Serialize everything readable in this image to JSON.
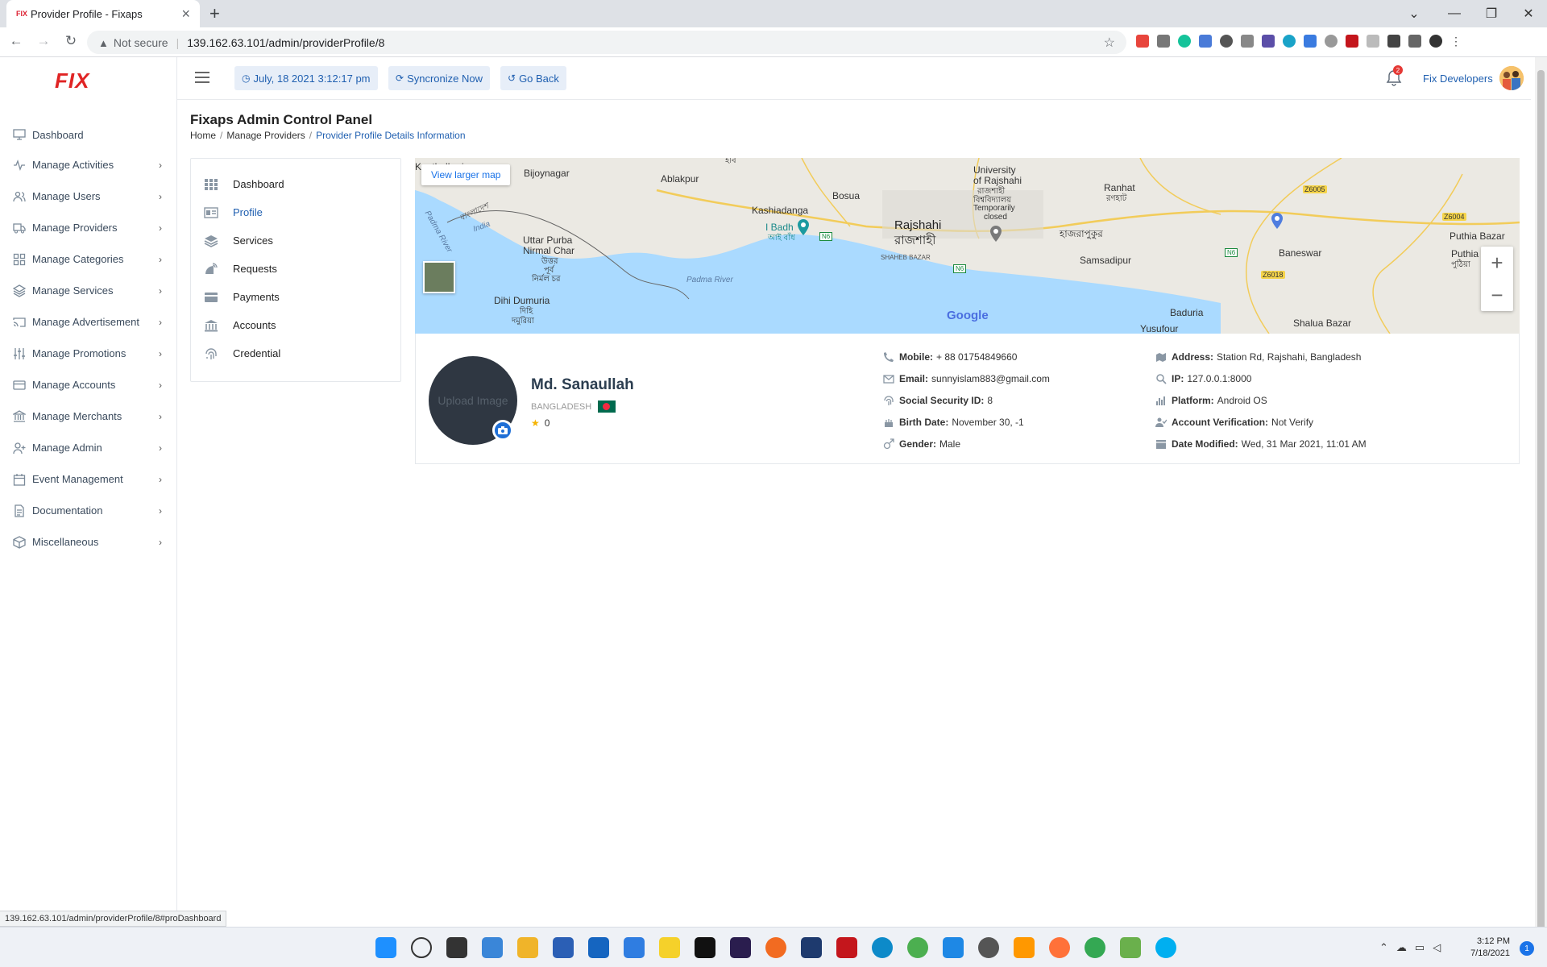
{
  "browser": {
    "tab_title": "Provider Profile - Fixaps",
    "favicon_text": "FIX",
    "security_label": "Not secure",
    "url": "139.162.63.101/admin/providerProfile/8",
    "status_url": "139.162.63.101/admin/providerProfile/8#proDashboard"
  },
  "app": {
    "logo_text": "FIX",
    "brand_color": "#e02424",
    "accent_color": "#1f5fb0"
  },
  "sidebar": {
    "items": [
      {
        "label": "Dashboard",
        "icon": "monitor-icon",
        "has_children": false
      },
      {
        "label": "Manage Activities",
        "icon": "activity-icon",
        "has_children": true
      },
      {
        "label": "Manage Users",
        "icon": "users-icon",
        "has_children": true
      },
      {
        "label": "Manage Providers",
        "icon": "truck-icon",
        "has_children": true
      },
      {
        "label": "Manage Categories",
        "icon": "grid-icon",
        "has_children": true
      },
      {
        "label": "Manage Services",
        "icon": "layers-icon",
        "has_children": true
      },
      {
        "label": "Manage Advertisement",
        "icon": "cast-icon",
        "has_children": true
      },
      {
        "label": "Manage Promotions",
        "icon": "sliders-icon",
        "has_children": true
      },
      {
        "label": "Manage Accounts",
        "icon": "credit-card-icon",
        "has_children": true
      },
      {
        "label": "Manage Merchants",
        "icon": "bank-icon",
        "has_children": true
      },
      {
        "label": "Manage Admin",
        "icon": "user-plus-icon",
        "has_children": true
      },
      {
        "label": "Event Management",
        "icon": "calendar-icon",
        "has_children": true
      },
      {
        "label": "Documentation",
        "icon": "file-icon",
        "has_children": true
      },
      {
        "label": "Miscellaneous",
        "icon": "box-icon",
        "has_children": true
      }
    ]
  },
  "header": {
    "datetime_label": "July, 18 2021 3:12:17 pm",
    "sync_label": "Syncronize Now",
    "back_label": "Go Back",
    "notification_count": "2",
    "user_name": "Fix Developers"
  },
  "page": {
    "title": "Fixaps Admin Control Panel",
    "breadcrumb": [
      "Home",
      "Manage Providers",
      "Provider Profile Details Information"
    ]
  },
  "profile_nav": [
    {
      "label": "Dashboard",
      "icon": "grid-icon",
      "active": false
    },
    {
      "label": "Profile",
      "icon": "id-card-icon",
      "active": true
    },
    {
      "label": "Services",
      "icon": "layers-icon",
      "active": false
    },
    {
      "label": "Requests",
      "icon": "satellite-dish-icon",
      "active": false
    },
    {
      "label": "Payments",
      "icon": "credit-card-icon",
      "active": false
    },
    {
      "label": "Accounts",
      "icon": "bank-icon",
      "active": false
    },
    {
      "label": "Credential",
      "icon": "fingerprint-icon",
      "active": false
    }
  ],
  "map": {
    "view_larger": "View larger map",
    "zoom_in": "+",
    "zoom_out": "−",
    "attribution": "Google",
    "labels": {
      "kanthalbari": "Kanthalbari",
      "bijoynagar": "Bijoynagar",
      "ablakpur": "Ablakpur",
      "bosua": "Bosua",
      "univ1": "University",
      "univ2": "of Rajshahi",
      "univ3": "রাজশাহী",
      "univ4": "বিশ্ববিদ্যালয়",
      "univ5": "Temporarily",
      "univ6": "closed",
      "ranhat": "Ranhat",
      "ranhat_bn": "রণহাট",
      "kashiadanga": "Kashiadanga",
      "rajshahi": "Rajshahi",
      "rajshahi_bn": "রাজশাহী",
      "hajrapukur": "হাজরাপুকুর",
      "badh": "I Badh",
      "badh_bn": "আই বাঁধ",
      "shaheb": "SHAHEB BAZAR",
      "samsadipur": "Samsadipur",
      "baneswar": "Baneswar",
      "puthia": "Puthia Bazar",
      "puthia2": "Puthia",
      "puthia_bn": "পুঠিয়া",
      "india": "India",
      "india_bn": "বাংলাদেশ",
      "uttar1": "Uttar Purba",
      "uttar2": "Nirmal Char",
      "uttar3": "উত্তর",
      "uttar4": "পূর্ব",
      "uttar5": "নির্মল চর",
      "padma": "Padma River",
      "padma2": "Padma River",
      "dihi1": "Dihi Dumuria",
      "dihi2": "দিহি",
      "dihi3": "দমুরিয়া",
      "baduria": "Baduria",
      "yusufour": "Yusufour",
      "shalua": "Shalua Bazar",
      "z6005": "Z6005",
      "z6004": "Z6004",
      "z6018": "Z6018",
      "n6a": "N6",
      "n6b": "N6",
      "n6c": "N6",
      "bn_top": "ইবি"
    }
  },
  "profile": {
    "upload_label": "Upload Image",
    "name": "Md. Sanaullah",
    "country": "BANGLADESH",
    "rating": "0",
    "mobile_label": "Mobile:",
    "mobile": "+ 88 01754849660",
    "email_label": "Email:",
    "email": "sunnyislam883@gmail.com",
    "ssn_label": "Social Security ID:",
    "ssn": "8",
    "birth_label": "Birth Date:",
    "birth": "November 30, -1",
    "gender_label": "Gender:",
    "gender": "Male",
    "address_label": "Address:",
    "address": "Station Rd, Rajshahi, Bangladesh",
    "ip_label": "IP:",
    "ip": "127.0.0.1:8000",
    "platform_label": "Platform:",
    "platform": "Android OS",
    "verification_label": "Account Verification:",
    "verification": "Not Verify",
    "modified_label": "Date Modified:",
    "modified": "Wed, 31 Mar 2021, 11:01 AM"
  },
  "taskbar": {
    "time": "3:12 PM",
    "date": "7/18/2021",
    "notifications": "1"
  }
}
